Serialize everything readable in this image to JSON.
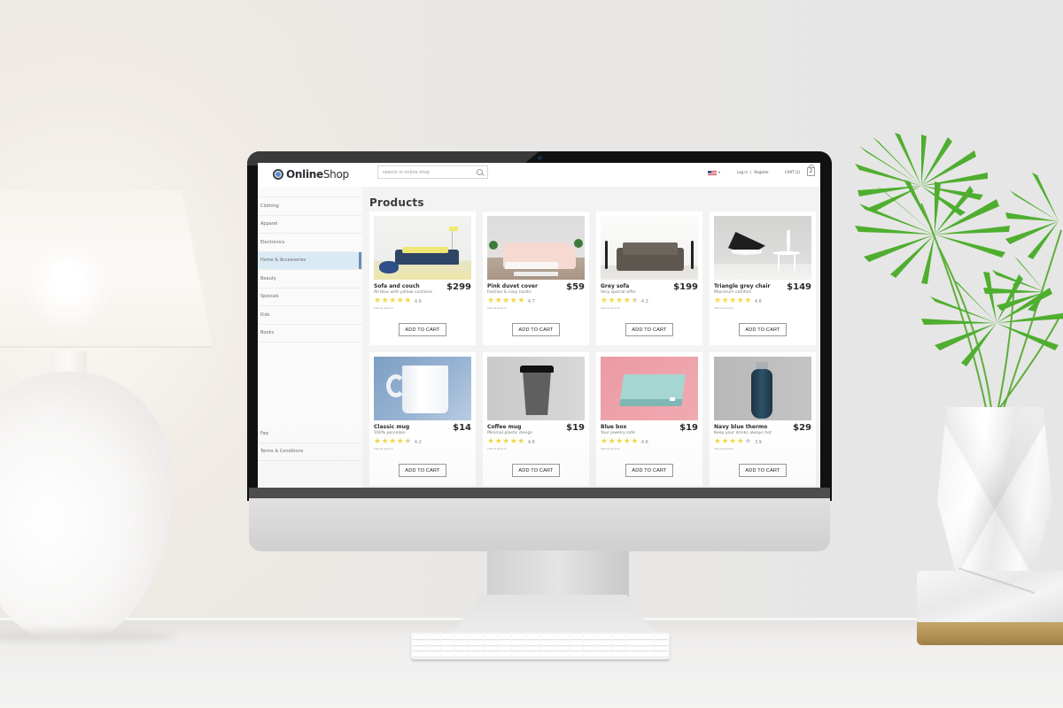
{
  "scene": {
    "description": "desktop monitor mockup on white desk with lamp and potted palm"
  },
  "header": {
    "logo": {
      "bold": "Online",
      "light": "Shop",
      "icon": "globe-logo-icon"
    },
    "search": {
      "placeholder": "search in online shop",
      "value": "",
      "icon": "search-icon"
    },
    "locale": {
      "flag": "us-flag-icon",
      "caret": "▾"
    },
    "auth": {
      "login": "Log in",
      "separator": "|",
      "register": "Register"
    },
    "cart": {
      "label": "CART (2)",
      "count": "2",
      "icon": "shopping-bag-icon"
    }
  },
  "sidebar": {
    "categories": [
      {
        "label": "Clothing",
        "active": false
      },
      {
        "label": "Apparel",
        "active": false
      },
      {
        "label": "Electronics",
        "active": false
      },
      {
        "label": "Home & Accessories",
        "active": true
      },
      {
        "label": "Beauty",
        "active": false
      },
      {
        "label": "Specials",
        "active": false
      },
      {
        "label": "Kids",
        "active": false
      },
      {
        "label": "Books",
        "active": false
      }
    ],
    "footer_links": [
      {
        "label": "Faq"
      },
      {
        "label": "Terms & Conditions"
      }
    ]
  },
  "main": {
    "title": "Products",
    "add_to_cart_label": "ADD TO CART",
    "opinions_label": "View all opinions",
    "products": [
      {
        "name": "Sofa and couch",
        "desc": "All blue with yellow cushions",
        "price": "$299",
        "rating": "4.6",
        "stars": 5,
        "image": "blue-sofa"
      },
      {
        "name": "Pink duvet cover",
        "desc": "Fashion & cozy nordic",
        "price": "$59",
        "rating": "4.7",
        "stars": 5,
        "image": "pink-bed"
      },
      {
        "name": "Grey sofa",
        "desc": "Very special offer",
        "price": "$199",
        "rating": "4.3",
        "stars": 4.5,
        "image": "grey-sofa"
      },
      {
        "name": "Triangle grey chair",
        "desc": "Maximum comfort",
        "price": "$149",
        "rating": "4.6",
        "stars": 5,
        "image": "triangle-chair"
      },
      {
        "name": "Classic mug",
        "desc": "100% porcelain",
        "price": "$14",
        "rating": "4.2",
        "stars": 4.5,
        "image": "white-mug"
      },
      {
        "name": "Coffee mug",
        "desc": "Minimal plastic design",
        "price": "$19",
        "rating": "4.8",
        "stars": 5,
        "image": "coffee-cup"
      },
      {
        "name": "Blue box",
        "desc": "Your jewelry safe",
        "price": "$19",
        "rating": "4.6",
        "stars": 5,
        "image": "blue-box"
      },
      {
        "name": "Navy blue thermo",
        "desc": "Keep your drinks always hot",
        "price": "$29",
        "rating": "3.9",
        "stars": 4,
        "image": "navy-thermo"
      }
    ]
  },
  "colors": {
    "accent_active": "#daeaf4",
    "active_bar": "#6f8cab",
    "star": "#f2d84b",
    "star_off": "#cfcfcf"
  }
}
